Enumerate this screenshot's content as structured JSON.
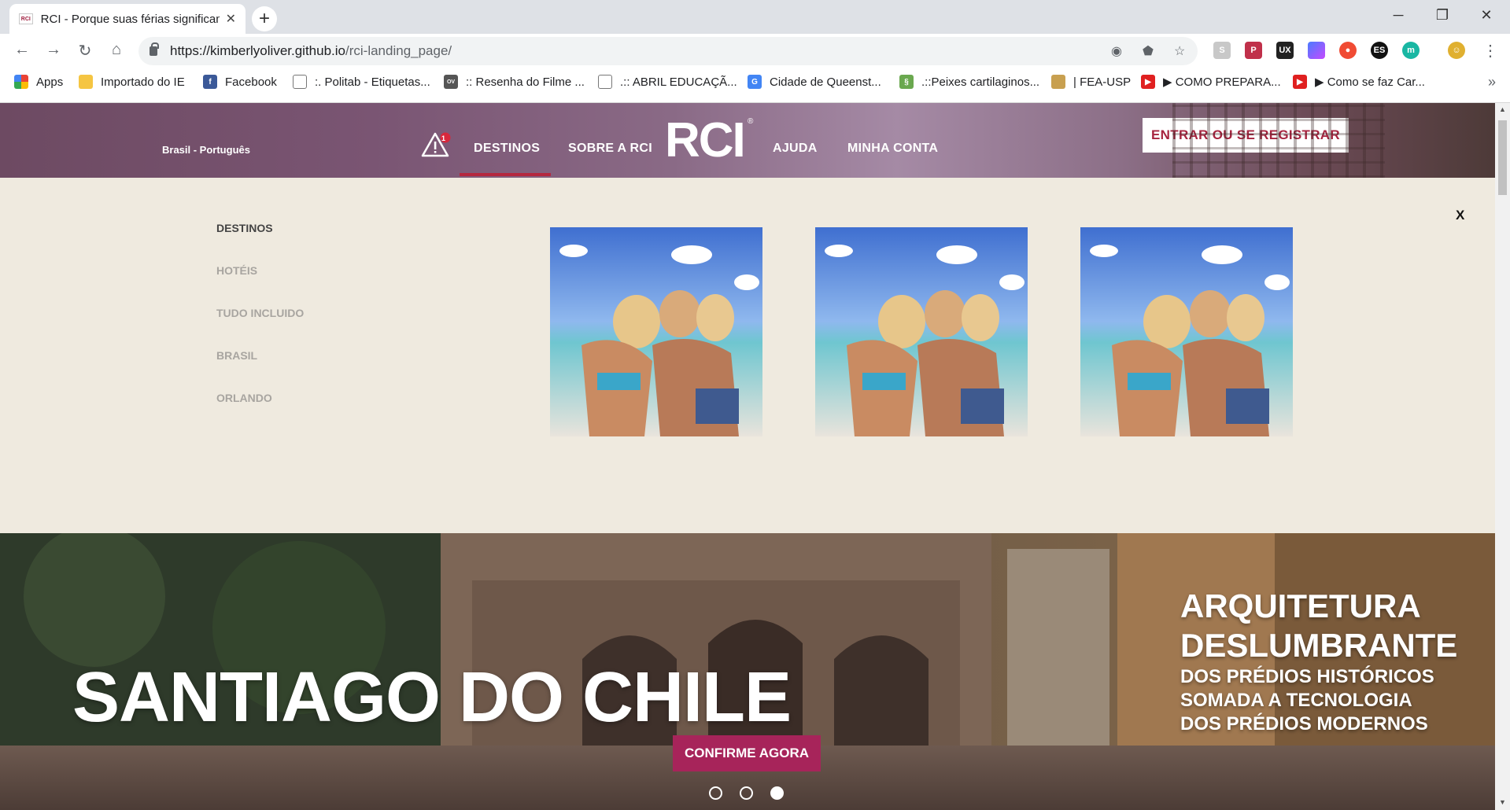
{
  "browser": {
    "tab_title": "RCI - Porque suas férias significam",
    "tab_favicon": "RCI",
    "url_host": "https://kimberlyoliver.github.io",
    "url_path": "/rci-landing_page/",
    "bookmarks": [
      {
        "label": "Apps",
        "icon": "apps-grid-icon"
      },
      {
        "label": "Importado do IE",
        "icon": "folder-icon"
      },
      {
        "label": "Facebook",
        "icon": "facebook-icon"
      },
      {
        "label": ":. Politab - Etiquetas...",
        "icon": "page-icon"
      },
      {
        "label": ":: Resenha do Filme ...",
        "icon": "site-icon"
      },
      {
        "label": ".:: ABRIL EDUCAÇÃ...",
        "icon": "page-icon"
      },
      {
        "label": "Cidade de Queenst...",
        "icon": "google-icon"
      },
      {
        "label": ".::Peixes cartilaginos...",
        "icon": "fish-icon"
      },
      {
        "label": "| FEA-USP",
        "icon": "fea-icon"
      },
      {
        "label": "▶ COMO PREPARA...",
        "icon": "youtube-icon"
      },
      {
        "label": "▶ Como se faz Car...",
        "icon": "youtube-icon"
      }
    ],
    "extensions": [
      "ES"
    ]
  },
  "header": {
    "locale": "Brasil - Português",
    "alert_count": "1",
    "nav": {
      "destinos": "DESTINOS",
      "sobre": "SOBRE A RCI",
      "ajuda": "AJUDA",
      "minha_conta": "MINHA CONTA"
    },
    "logo": "RCI",
    "logo_mark": "®",
    "login_button": "ENTRAR OU SE REGISTRAR"
  },
  "dropdown": {
    "menu": [
      "DESTINOS",
      "HOTÉIS",
      "TUDO INCLUIDO",
      "BRASIL",
      "ORLANDO"
    ],
    "active_index": 0,
    "close_label": "X"
  },
  "hero": {
    "title": "SANTIAGO DO CHILE",
    "cta": "CONFIRME AGORA",
    "side_line1": "ARQUITETURA",
    "side_line2": "DESLUMBRANTE",
    "side_line3": "DOS PRÉDIOS HISTÓRICOS",
    "side_line4": "SOMADA A TECNOLOGIA",
    "side_line5": "DOS PRÉDIOS MODERNOS",
    "slides_total": 3,
    "active_slide": 3
  },
  "colors": {
    "brand": "#a7243f",
    "cta": "#a7245a",
    "dropdown_bg": "#efeadf"
  }
}
